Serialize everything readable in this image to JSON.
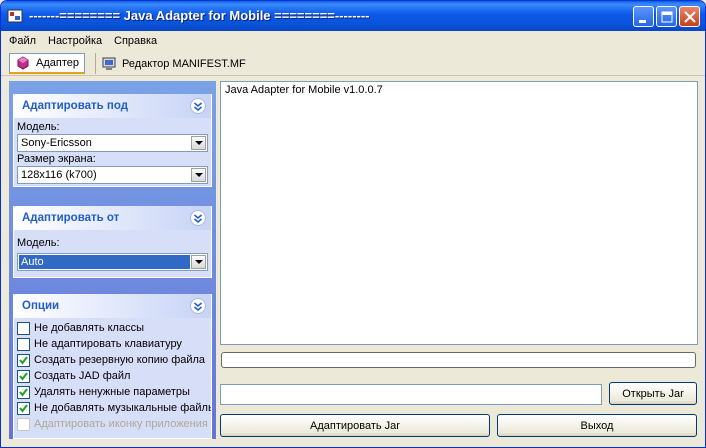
{
  "window": {
    "title": "-------======== Java Adapter for Mobile ========--------"
  },
  "menu": {
    "items": [
      "Файл",
      "Настройка",
      "Справка"
    ]
  },
  "tabs": [
    {
      "label": "Адаптер",
      "active": true,
      "icon": "adapter-icon"
    },
    {
      "label": "Редактор MANIFEST.MF",
      "active": false,
      "icon": "computer-icon"
    }
  ],
  "adapt_to": {
    "title": "Адаптировать под",
    "model_label": "Модель:",
    "model_value": "Sony-Ericsson",
    "screen_label": "Размер экрана:",
    "screen_value": "128x116 (k700)"
  },
  "adapt_from": {
    "title": "Адаптировать от",
    "model_label": "Модель:",
    "model_value": "Auto"
  },
  "options": {
    "title": "Опции",
    "items": [
      {
        "label": "Не добавлять классы",
        "checked": false,
        "enabled": true
      },
      {
        "label": "Не адаптировать клавиатуру",
        "checked": false,
        "enabled": true
      },
      {
        "label": "Создать резервную копию файла",
        "checked": true,
        "enabled": true
      },
      {
        "label": "Создать JAD файл",
        "checked": true,
        "enabled": true
      },
      {
        "label": "Удалять ненужные параметры",
        "checked": true,
        "enabled": true
      },
      {
        "label": "Не добавлять музыкальные файлы",
        "checked": true,
        "enabled": true
      },
      {
        "label": "Адаптировать иконку приложения",
        "checked": false,
        "enabled": false
      }
    ]
  },
  "log": {
    "text": "Java Adapter for Mobile v1.0.0.7"
  },
  "progress": {
    "value": 0
  },
  "jar_path": {
    "value": ""
  },
  "buttons": {
    "open_jar": "Открыть Jar",
    "adapt_jar": "Адаптировать Jar",
    "exit": "Выход"
  },
  "colors": {
    "titlebar": "#0a52d8",
    "taskpane": "#6f8ddf",
    "group_title": "#215dc6",
    "selection": "#316ac5",
    "check": "#21a121"
  }
}
